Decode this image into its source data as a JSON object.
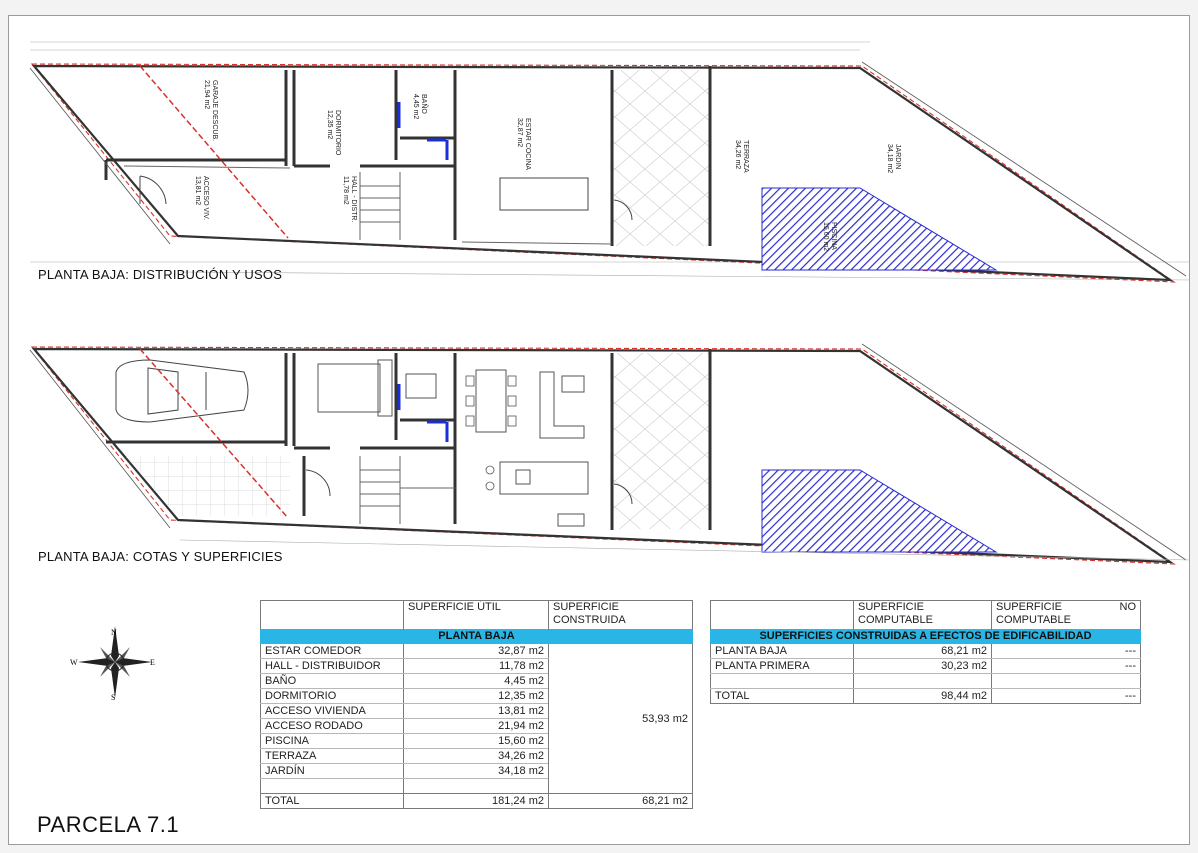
{
  "plans": {
    "upper_title": "PLANTA BAJA:  DISTRIBUCIÓN Y USOS",
    "lower_title": "PLANTA BAJA:  COTAS Y SUPERFICIES",
    "rooms": [
      {
        "name": "GARAJE DESCUB.",
        "area": "21,94 m2"
      },
      {
        "name": "DORMITORIO",
        "area": "12,35 m2"
      },
      {
        "name": "BAÑO",
        "area": "4,45 m2"
      },
      {
        "name": "ESTAR COCINA",
        "area": "32,87 m2"
      },
      {
        "name": "TERRAZA",
        "area": "34,26 m2"
      },
      {
        "name": "JARDIN",
        "area": "34,18 m2"
      },
      {
        "name": "ACCESO VIV.",
        "area": "13,81 m2"
      },
      {
        "name": "HALL - DISTR.",
        "area": "11,78 m2"
      },
      {
        "name": "PISCINA",
        "area": "15,60 m2"
      }
    ]
  },
  "parcel_label": "PARCELA 7.1",
  "compass": {
    "north": "N",
    "south": "S",
    "east": "E",
    "west": "W"
  },
  "colors": {
    "section_header": "#29b6e6",
    "pool_hatch": "#2b2bd1",
    "property_line": "#d9302b"
  },
  "table_left": {
    "headers": [
      "",
      "SUPERFICIE ÚTIL",
      "SUPERFICIE CONSTRUIDA"
    ],
    "section": "PLANTA BAJA",
    "rows": [
      {
        "label": "ESTAR COMEDOR",
        "util": "32,87 m2"
      },
      {
        "label": "HALL - DISTRIBUIDOR",
        "util": "11,78 m2"
      },
      {
        "label": "BAÑO",
        "util": "4,45 m2"
      },
      {
        "label": "DORMITORIO",
        "util": "12,35 m2"
      },
      {
        "label": "ACCESO VIVIENDA",
        "util": "13,81 m2"
      },
      {
        "label": "ACCESO RODADO",
        "util": "21,94 m2"
      },
      {
        "label": "PISCINA",
        "util": "15,60 m2"
      },
      {
        "label": "TERRAZA",
        "util": "34,26 m2"
      },
      {
        "label": "JARDÍN",
        "util": "34,18 m2"
      }
    ],
    "subtotal_construida": "53,93 m2",
    "total": {
      "label": "TOTAL",
      "util": "181,24 m2",
      "construida": "68,21 m2"
    }
  },
  "table_right": {
    "headers": [
      "",
      "SUPERFICIE COMPUTABLE",
      "SUPERFICIE",
      "NO",
      "COMPUTABLE"
    ],
    "section": "SUPERFICIES CONSTRUIDAS A EFECTOS DE EDIFICABILIDAD",
    "rows": [
      {
        "label": "PLANTA BAJA",
        "computable": "68,21 m2",
        "no_computable": "---"
      },
      {
        "label": "PLANTA PRIMERA",
        "computable": "30,23 m2",
        "no_computable": "---"
      }
    ],
    "total": {
      "label": "TOTAL",
      "computable": "98,44 m2",
      "no_computable": "---"
    }
  }
}
